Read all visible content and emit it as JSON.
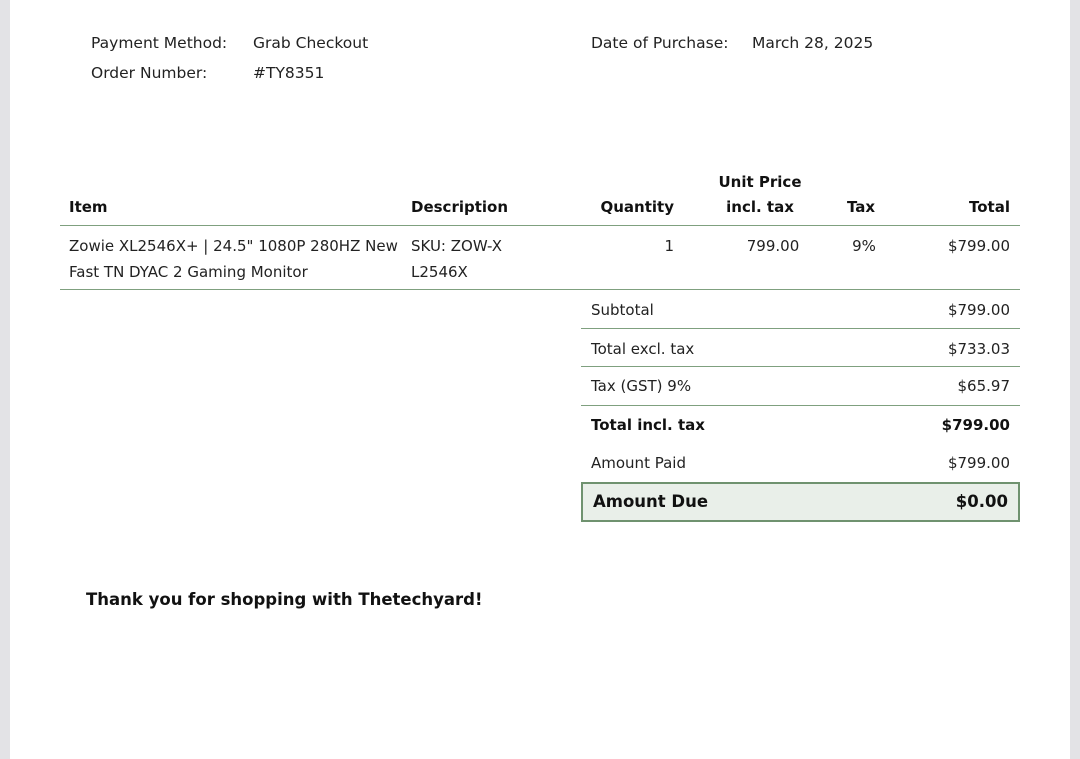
{
  "meta": {
    "payment_method_label": "Payment Method:",
    "payment_method_value": "Grab Checkout",
    "order_number_label": "Order Number:",
    "order_number_value": "#TY8351",
    "date_label": "Date of Purchase:",
    "date_value": "March 28, 2025"
  },
  "table": {
    "headers": {
      "item": "Item",
      "description": "Description",
      "quantity": "Quantity",
      "unit_price_line1": "Unit Price",
      "unit_price_line2": "incl. tax",
      "tax": "Tax",
      "total": "Total"
    },
    "rows": [
      {
        "item": "Zowie XL2546X+ | 24.5\" 1080P 280HZ New Fast TN DYAC 2 Gaming Monitor",
        "description": "SKU: ZOW-XL2546X",
        "quantity": "1",
        "unit_price": "799.00",
        "tax": "9%",
        "total": "$799.00"
      }
    ]
  },
  "summary": {
    "subtotal_label": "Subtotal",
    "subtotal_value": "$799.00",
    "excl_tax_label": "Total excl. tax",
    "excl_tax_value": "$733.03",
    "gst_label": "Tax (GST) 9%",
    "gst_value": "$65.97",
    "incl_tax_label": "Total incl. tax",
    "incl_tax_value": "$799.00",
    "paid_label": "Amount Paid",
    "paid_value": "$799.00",
    "due_label": "Amount Due",
    "due_value": "$0.00"
  },
  "footer": {
    "thanks": "Thank you for shopping with Thetechyard!"
  }
}
